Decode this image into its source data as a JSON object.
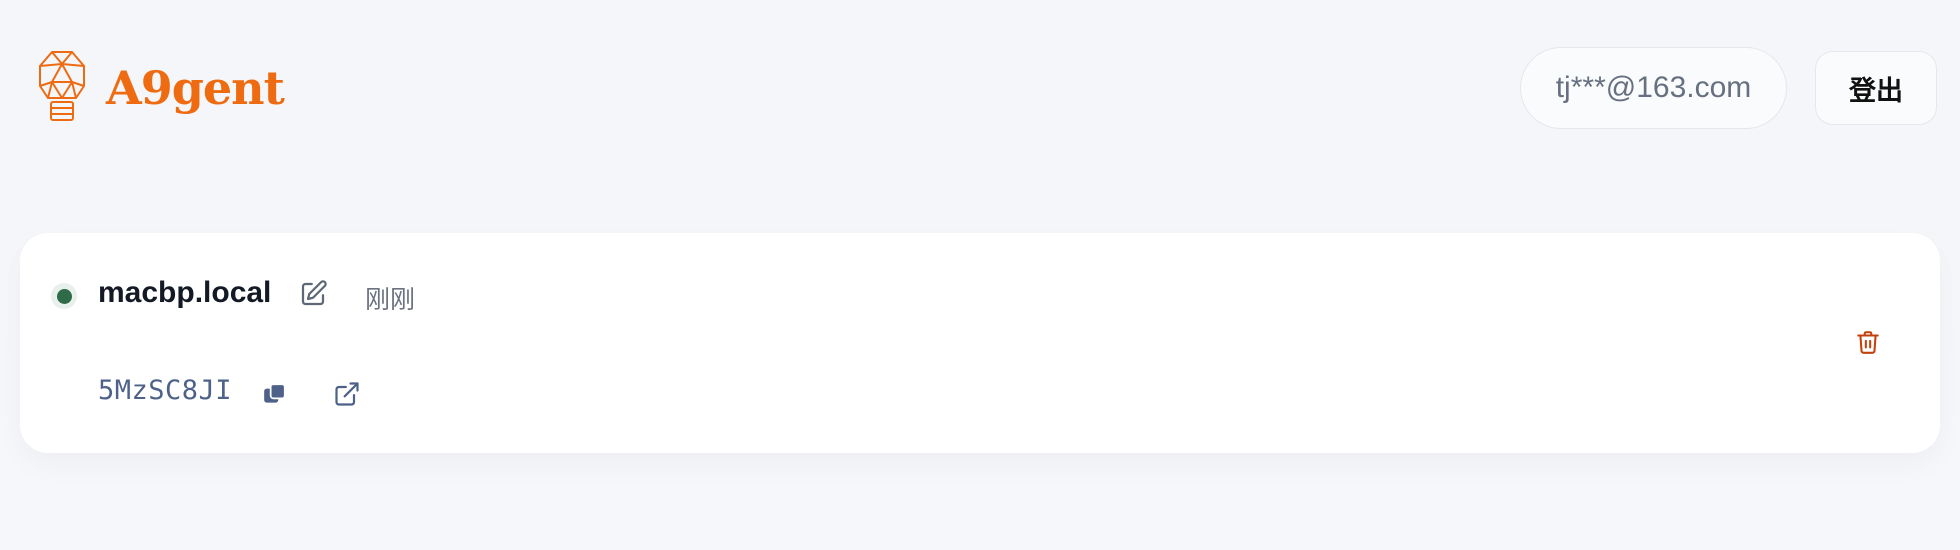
{
  "header": {
    "brand_name": "A9gent",
    "user_email": "tj***@163.com",
    "logout_label": "登出"
  },
  "device": {
    "name": "macbp.local",
    "status": "online",
    "last_seen": "刚刚",
    "code": "5MzSC8JI"
  },
  "icons": {
    "logo": "geometric-lightbulb-icon",
    "edit": "edit-icon",
    "copy": "copy-icon",
    "open": "external-link-icon",
    "delete": "trash-icon"
  },
  "colors": {
    "brand": "#ee6b12",
    "online": "#2f6b48",
    "code": "#4e6289",
    "danger": "#c2410c"
  }
}
